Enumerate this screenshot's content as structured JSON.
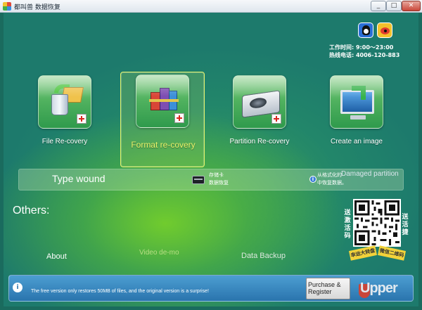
{
  "window": {
    "title": "都叫兽 数据恢复",
    "minimize": "_",
    "maximize": "□",
    "close": "✕"
  },
  "contact": {
    "hours": "工作时间: 9:00～23:00",
    "hotline": "热线电话: 4006-120-883"
  },
  "tiles": [
    {
      "label": "File Re-covery",
      "icon": "file-recovery-icon",
      "selected": false
    },
    {
      "label": "Format re-covery",
      "icon": "format-recovery-icon",
      "selected": true
    },
    {
      "label": "Partition Re-covery",
      "icon": "partition-recovery-icon",
      "selected": false
    },
    {
      "label": "Create an image",
      "icon": "create-image-icon",
      "selected": false
    }
  ],
  "info_bar": {
    "type_wound": "Type wound",
    "card_line1": "存储卡",
    "card_line2": "数据恢复",
    "format_line1": "从格式化的",
    "format_line2": "中恢复数据。",
    "damaged": "Damaged partition"
  },
  "others": {
    "heading": "Others:",
    "about": "About",
    "video": "Video de-mo",
    "backup": "Data Backup"
  },
  "qr": {
    "left_text": "送激活码",
    "right_text": "送活捷",
    "ribbon_left": "幸运大转盘",
    "ribbon_right": "微信二维码"
  },
  "bottom": {
    "info_glyph": "i",
    "free_notice": "The free version only restores 50MB of files, and the original version is a surprise!",
    "purchase": "Purchase & Register",
    "brand": "Upper"
  },
  "colors": {
    "accent": "#e8f36a",
    "main_bg": "#1f7f6a",
    "bottom_bar": "#2a74ad"
  }
}
